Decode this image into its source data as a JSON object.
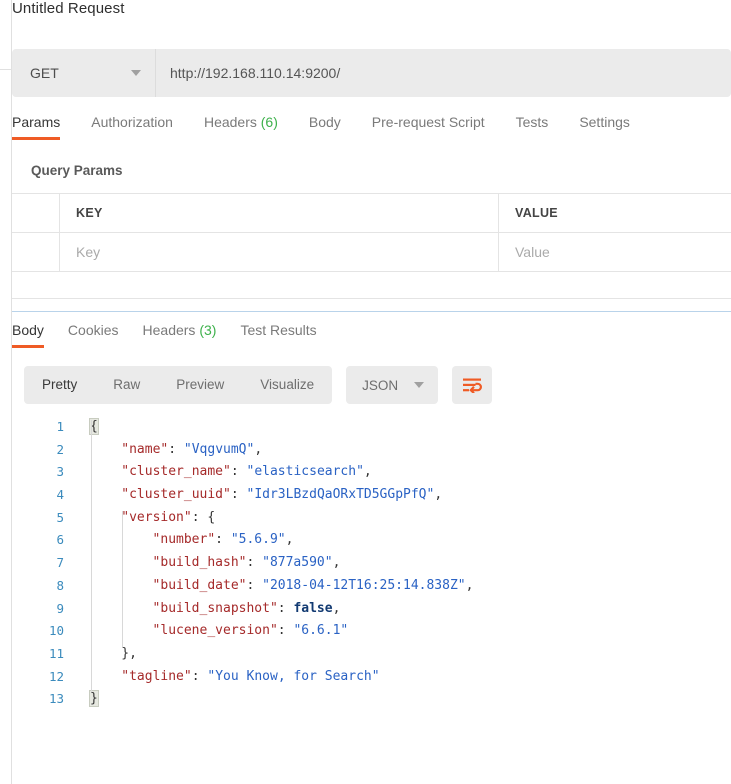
{
  "request": {
    "title": "Untitled Request",
    "method": "GET",
    "method_caret_icon": "chevron-down-icon",
    "url": "http://192.168.110.14:9200/",
    "tabs": [
      {
        "label": "Params",
        "active": true,
        "count": ""
      },
      {
        "label": "Authorization",
        "active": false,
        "count": ""
      },
      {
        "label": "Headers",
        "active": false,
        "count": "(6)"
      },
      {
        "label": "Body",
        "active": false,
        "count": ""
      },
      {
        "label": "Pre-request Script",
        "active": false,
        "count": ""
      },
      {
        "label": "Tests",
        "active": false,
        "count": ""
      },
      {
        "label": "Settings",
        "active": false,
        "count": ""
      }
    ],
    "query_params": {
      "section_label": "Query Params",
      "columns": [
        "KEY",
        "VALUE"
      ],
      "row_placeholders": {
        "key": "Key",
        "value": "Value"
      }
    }
  },
  "response": {
    "tabs": [
      {
        "label": "Body",
        "active": true,
        "count": ""
      },
      {
        "label": "Cookies",
        "active": false,
        "count": ""
      },
      {
        "label": "Headers",
        "active": false,
        "count": "(3)"
      },
      {
        "label": "Test Results",
        "active": false,
        "count": ""
      }
    ],
    "view_modes": [
      {
        "label": "Pretty",
        "active": true
      },
      {
        "label": "Raw",
        "active": false
      },
      {
        "label": "Preview",
        "active": false
      },
      {
        "label": "Visualize",
        "active": false
      }
    ],
    "format": {
      "label": "JSON",
      "caret_icon": "chevron-down-icon"
    },
    "wrap_button_icon": "word-wrap-icon",
    "body_lines": [
      {
        "n": "1",
        "indent": 0,
        "tokens": [
          {
            "t": "{",
            "c": "pun-hl"
          }
        ]
      },
      {
        "n": "2",
        "indent": 1,
        "tokens": [
          {
            "t": "\"name\"",
            "c": "key"
          },
          {
            "t": ": ",
            "c": "pun"
          },
          {
            "t": "\"VqgvumQ\"",
            "c": "str"
          },
          {
            "t": ",",
            "c": "pun"
          }
        ]
      },
      {
        "n": "3",
        "indent": 1,
        "tokens": [
          {
            "t": "\"cluster_name\"",
            "c": "key"
          },
          {
            "t": ": ",
            "c": "pun"
          },
          {
            "t": "\"elasticsearch\"",
            "c": "str"
          },
          {
            "t": ",",
            "c": "pun"
          }
        ]
      },
      {
        "n": "4",
        "indent": 1,
        "tokens": [
          {
            "t": "\"cluster_uuid\"",
            "c": "key"
          },
          {
            "t": ": ",
            "c": "pun"
          },
          {
            "t": "\"Idr3LBzdQaORxTD5GGpPfQ\"",
            "c": "str"
          },
          {
            "t": ",",
            "c": "pun"
          }
        ]
      },
      {
        "n": "5",
        "indent": 1,
        "tokens": [
          {
            "t": "\"version\"",
            "c": "key"
          },
          {
            "t": ": {",
            "c": "pun"
          }
        ]
      },
      {
        "n": "6",
        "indent": 2,
        "tokens": [
          {
            "t": "\"number\"",
            "c": "key"
          },
          {
            "t": ": ",
            "c": "pun"
          },
          {
            "t": "\"5.6.9\"",
            "c": "str"
          },
          {
            "t": ",",
            "c": "pun"
          }
        ]
      },
      {
        "n": "7",
        "indent": 2,
        "tokens": [
          {
            "t": "\"build_hash\"",
            "c": "key"
          },
          {
            "t": ": ",
            "c": "pun"
          },
          {
            "t": "\"877a590\"",
            "c": "str"
          },
          {
            "t": ",",
            "c": "pun"
          }
        ]
      },
      {
        "n": "8",
        "indent": 2,
        "tokens": [
          {
            "t": "\"build_date\"",
            "c": "key"
          },
          {
            "t": ": ",
            "c": "pun"
          },
          {
            "t": "\"2018-04-12T16:25:14.838Z\"",
            "c": "str"
          },
          {
            "t": ",",
            "c": "pun"
          }
        ]
      },
      {
        "n": "9",
        "indent": 2,
        "tokens": [
          {
            "t": "\"build_snapshot\"",
            "c": "key"
          },
          {
            "t": ": ",
            "c": "pun"
          },
          {
            "t": "false",
            "c": "bool"
          },
          {
            "t": ",",
            "c": "pun"
          }
        ]
      },
      {
        "n": "10",
        "indent": 2,
        "tokens": [
          {
            "t": "\"lucene_version\"",
            "c": "key"
          },
          {
            "t": ": ",
            "c": "pun"
          },
          {
            "t": "\"6.6.1\"",
            "c": "str"
          }
        ]
      },
      {
        "n": "11",
        "indent": 1,
        "tokens": [
          {
            "t": "},",
            "c": "pun"
          }
        ]
      },
      {
        "n": "12",
        "indent": 1,
        "tokens": [
          {
            "t": "\"tagline\"",
            "c": "key"
          },
          {
            "t": ": ",
            "c": "pun"
          },
          {
            "t": "\"You Know, for Search\"",
            "c": "str"
          }
        ]
      },
      {
        "n": "13",
        "indent": 0,
        "tokens": [
          {
            "t": "}",
            "c": "pun-hl"
          }
        ]
      }
    ]
  },
  "colors": {
    "accent": "#ef5b25",
    "count_green": "#3db14b",
    "json_key": "#a52a2a",
    "json_string": "#2a62c4",
    "json_bool": "#123a72",
    "line_number": "#3b8bbd",
    "toolbar_bg": "#ebebeb",
    "divider_blue": "#b9d3ea"
  }
}
